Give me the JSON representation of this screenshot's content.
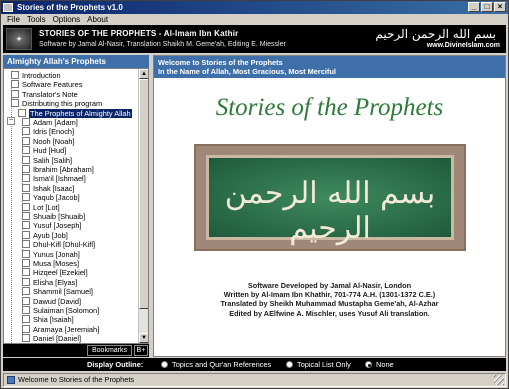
{
  "window": {
    "title": "Stories of the Prophets v1.0"
  },
  "menu": [
    "File",
    "Tools",
    "Options",
    "About"
  ],
  "header": {
    "title": "STORIES OF THE PROPHETS - Al-Imam Ibn Kathir",
    "subtitle": "Software by Jamal Al-Nasir, Translation Shaikh M. Geme'ah, Editing E. Miessler",
    "calligraphy": "بسم الله الرحمن الرحيم",
    "site": "www.DivineIslam.com"
  },
  "sidebar": {
    "heading": "Almighty Allah's Prophets",
    "intro_items": [
      "Introduction",
      "Software Features",
      "Translator's Note",
      "Distributing this program"
    ],
    "group_label": "The Prophets of Almighty Allah",
    "prophets": [
      "Adam [Adam]",
      "Idris [Enoch]",
      "Nooh [Noah]",
      "Hud [Hud]",
      "Salih [Salih]",
      "Ibrahim [Abraham]",
      "Isma'il [Ishmael]",
      "Ishak [Isaac]",
      "Yaqub [Jacob]",
      "Lot [Lot]",
      "Shuaib [Shuaib]",
      "Yusuf [Joseph]",
      "Ayub [Job]",
      "Dhul-Kifl [Dhul-Kifl]",
      "Yunus [Jonah]",
      "Musa [Moses]",
      "Hizqeel [Ezekiel]",
      "Elisha [Elyas]",
      "Shammil [Samuel]",
      "Dawud [David]",
      "Sulaiman [Solomon]",
      "Shia [Isaiah]",
      "Aramaya [Jeremiah]",
      "Daniel [Daniel]",
      "Uzair [Ezra]"
    ],
    "bookmarks_label": "Bookmarks",
    "plus_label": "B+"
  },
  "content": {
    "heading_line1": "Welcome to Stories of the Prophets",
    "heading_line2": "In the Name of Allah, Most Gracious, Most Merciful",
    "big_title": "Stories of the Prophets",
    "art_calligraphy": "بسم الله الرحمن الرحيم",
    "credits": [
      "Software Developed by Jamal Al-Nasir, London",
      "Written by Al-Imam Ibn Khathir, 701-774 A.H. (1301-1372 C.E.)",
      "Translated by Sheikh Muhammad Mustapha Geme'ah, Al-Azhar",
      "Edited by AElfwine A. Mischler, uses Yusuf Ali translation."
    ]
  },
  "outline": {
    "label": "Display Outline:",
    "options": [
      "Topics and Qur'an References",
      "Topical List Only",
      "None"
    ],
    "selected": "None"
  },
  "status": {
    "text": "Welcome to Stories of the Prophets"
  },
  "colors": {
    "panel_header": "#3e6fa8",
    "title_green": "#2e7a3a",
    "selection": "#0a246a"
  }
}
